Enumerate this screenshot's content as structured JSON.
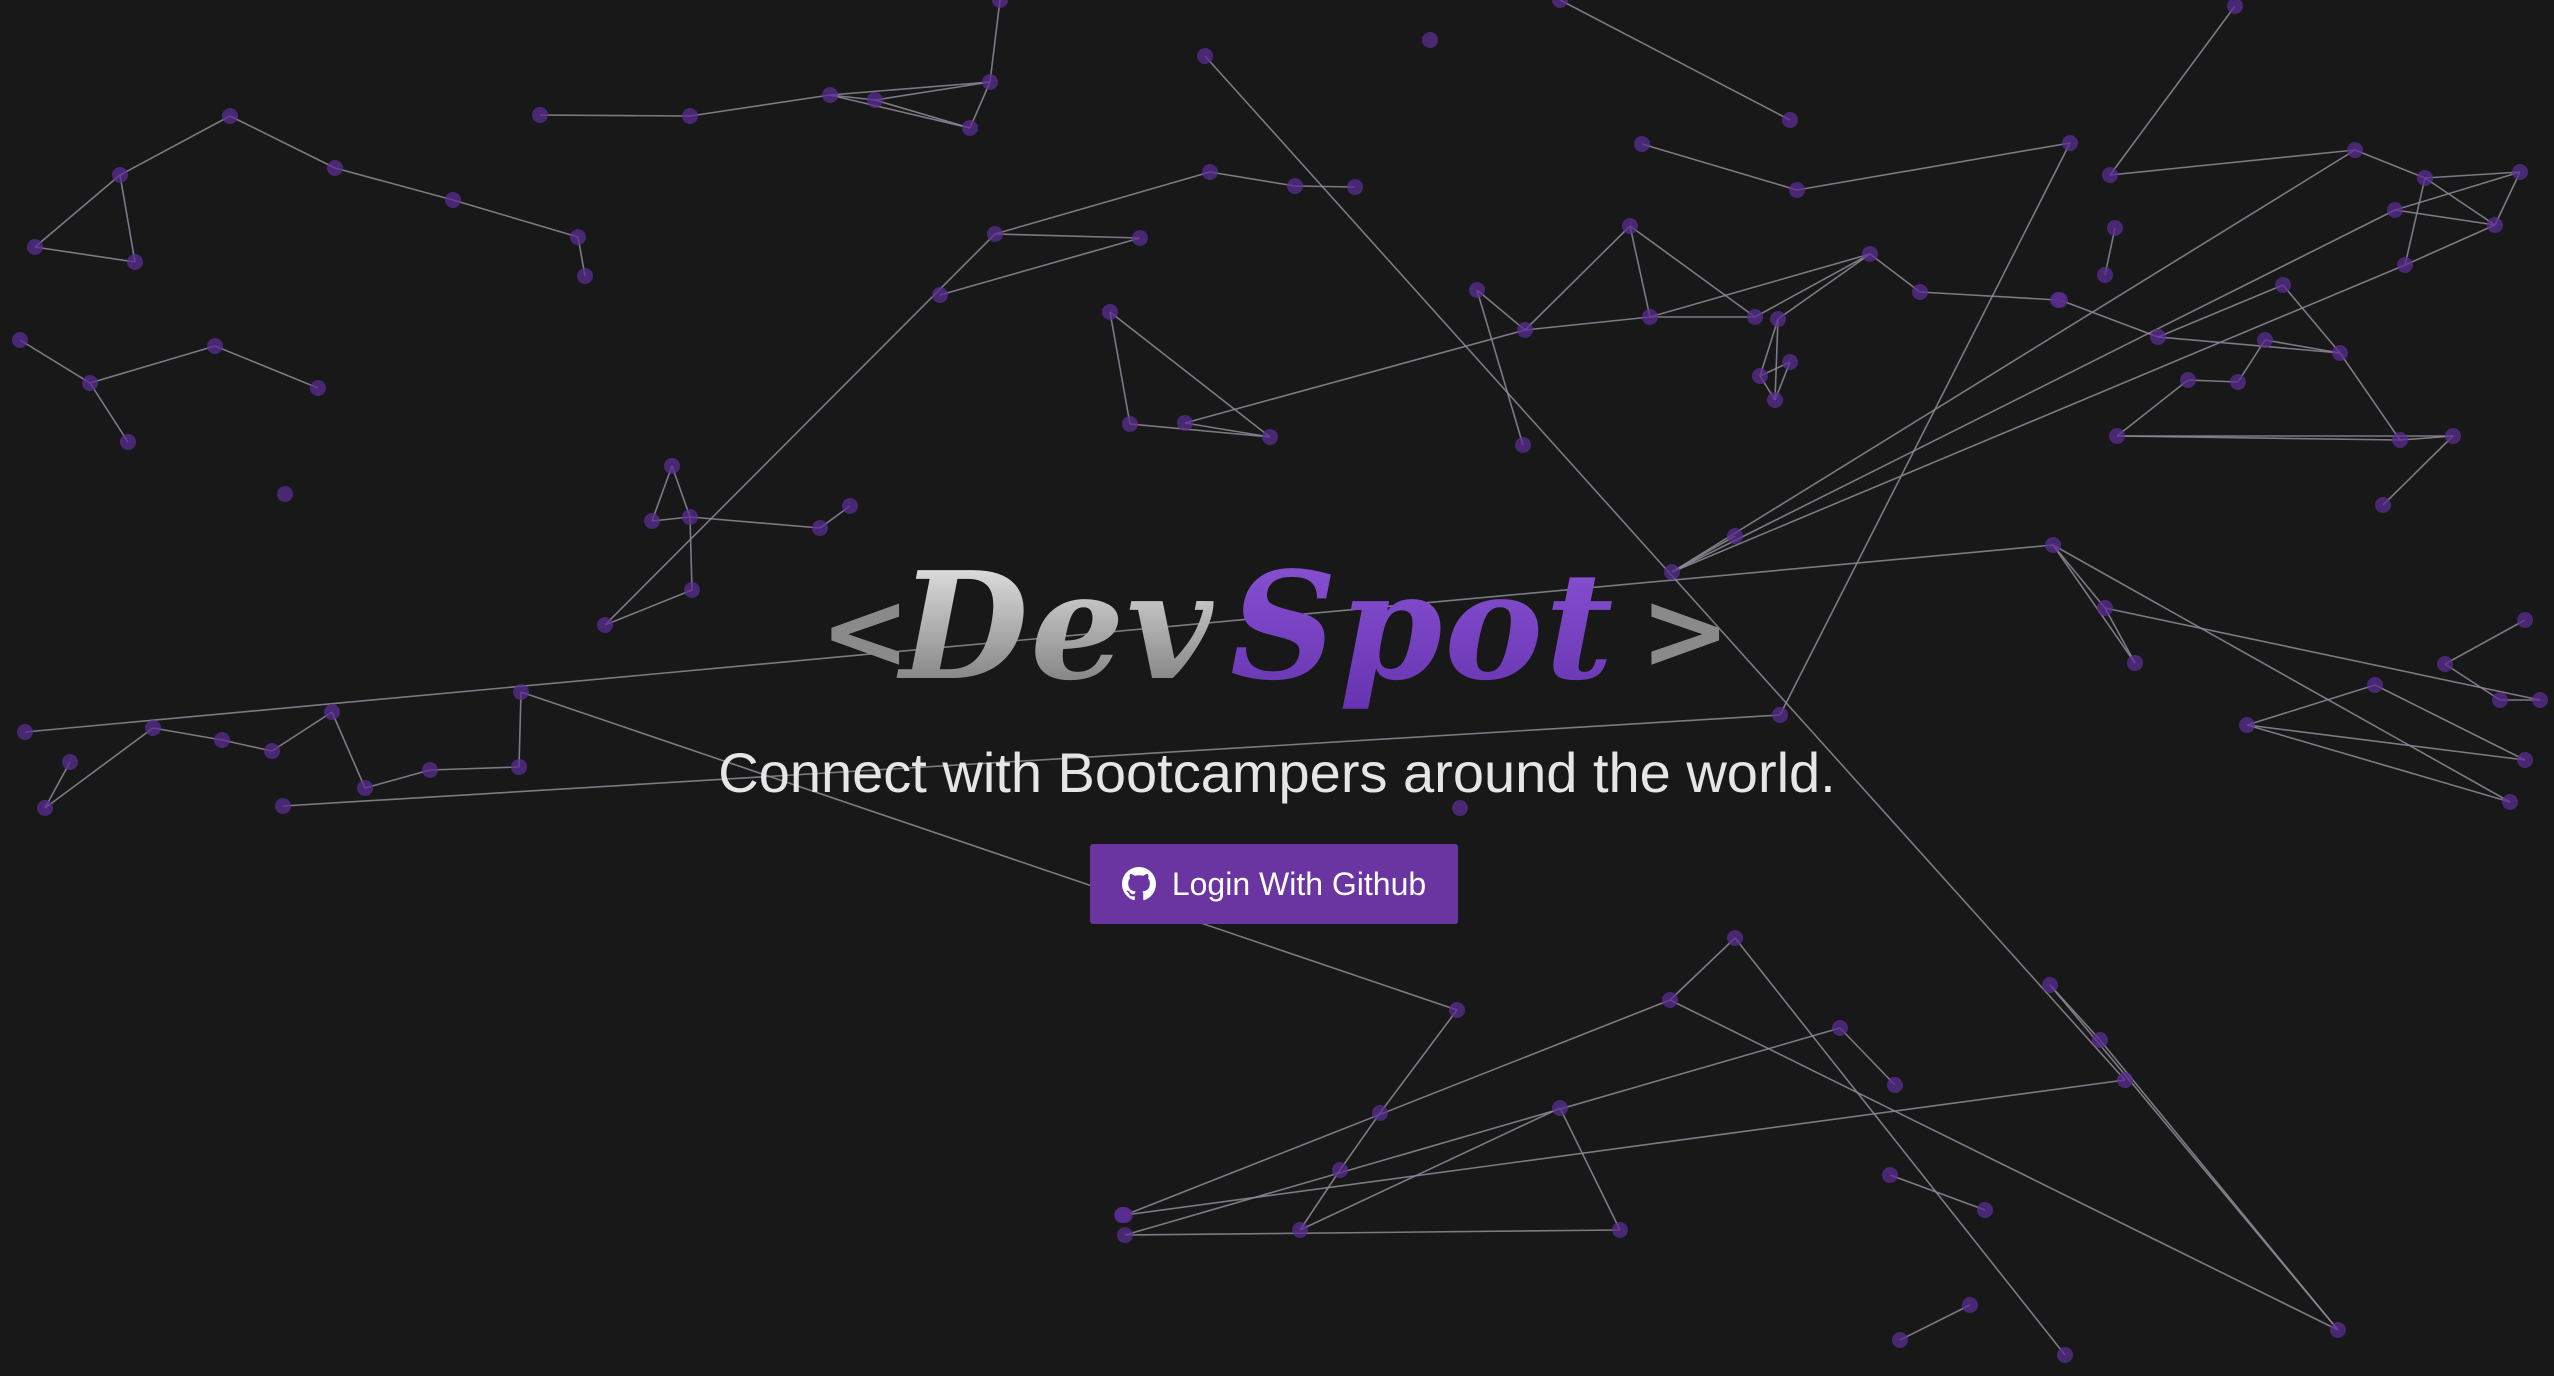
{
  "logo": {
    "open_bracket": "<",
    "word_dev": "Dev",
    "word_spot": "Spot",
    "close_bracket": ">"
  },
  "hero": {
    "tagline": "Connect with Bootcampers around the world."
  },
  "login": {
    "label": "Login With Github",
    "icon": "github-icon"
  },
  "colors": {
    "background": "#181818",
    "accent": "#6a35a1",
    "logo_purple": "#7b43c4",
    "logo_silver": "#bdbdbd",
    "node": "#5a2d91",
    "edge": "#8f8a99"
  }
}
